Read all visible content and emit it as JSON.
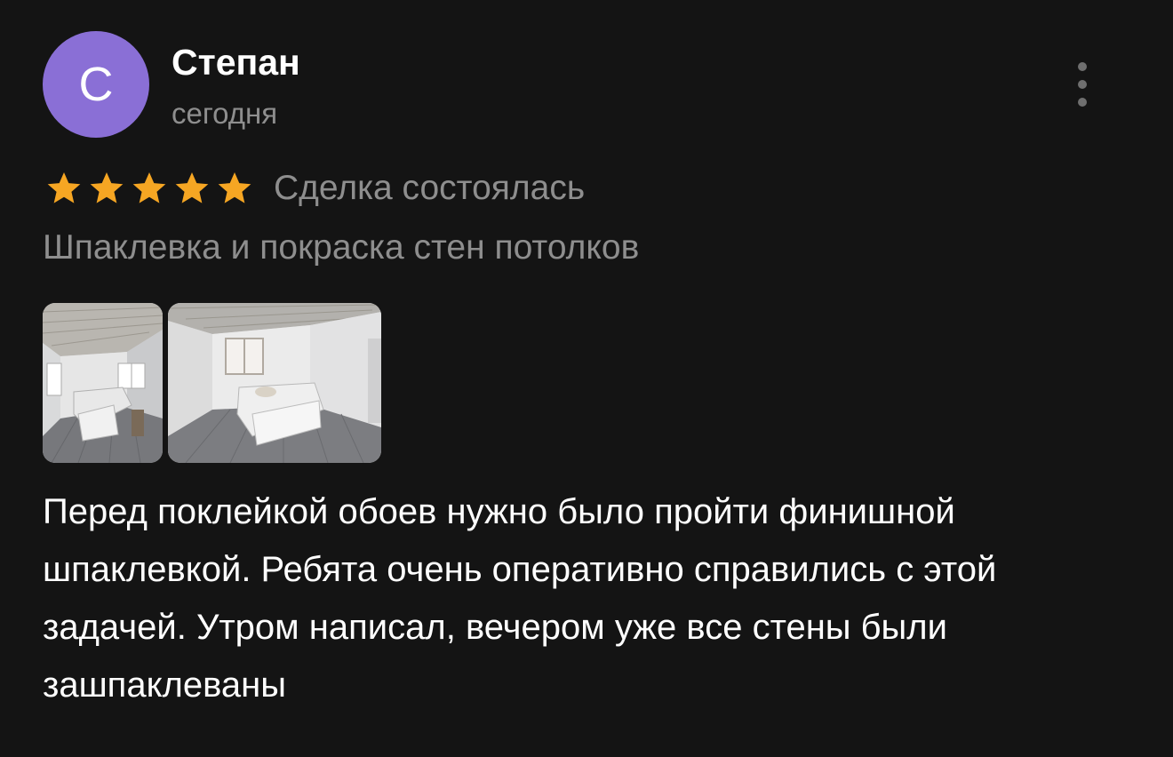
{
  "author": {
    "initial": "С",
    "name": "Степан",
    "date": "сегодня",
    "avatar_color": "#8a6fd6"
  },
  "rating": {
    "stars": 5,
    "max": 5,
    "star_color": "#f6a623",
    "deal_status": "Сделка состоялась"
  },
  "service": "Шпаклевка и покраска стен потолков",
  "photos": [
    {
      "description_icon": "room-photo"
    },
    {
      "description_icon": "room-photo"
    }
  ],
  "review_text": "Перед поклейкой обоев нужно было пройти финишной шпаклевкой. Ребята очень оперативно справились с этой задачей. Утром написал, вечером уже все стены были зашпаклеваны",
  "menu_icon": "more-vertical-icon"
}
